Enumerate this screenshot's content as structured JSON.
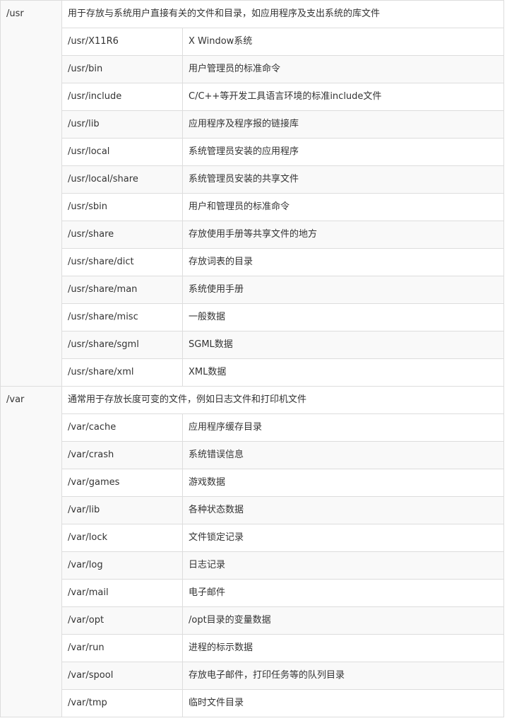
{
  "groups": [
    {
      "dir": "/usr",
      "description": "用于存放与系统用户直接有关的文件和目录，如应用程序及支出系统的库文件",
      "children": [
        {
          "path": "/usr/X11R6",
          "desc": "X Window系统"
        },
        {
          "path": "/usr/bin",
          "desc": "用户管理员的标准命令"
        },
        {
          "path": "/usr/include",
          "desc": "C/C++等开发工具语言环境的标准include文件"
        },
        {
          "path": "/usr/lib",
          "desc": "应用程序及程序报的链接库"
        },
        {
          "path": "/usr/local",
          "desc": "系统管理员安装的应用程序"
        },
        {
          "path": "/usr/local/share",
          "desc": "系统管理员安装的共享文件"
        },
        {
          "path": "/usr/sbin",
          "desc": "用户和管理员的标准命令"
        },
        {
          "path": "/usr/share",
          "desc": "存放使用手册等共享文件的地方"
        },
        {
          "path": "/usr/share/dict",
          "desc": "存放词表的目录"
        },
        {
          "path": "/usr/share/man",
          "desc": "系统使用手册"
        },
        {
          "path": "/usr/share/misc",
          "desc": "一般数据"
        },
        {
          "path": "/usr/share/sgml",
          "desc": "SGML数据"
        },
        {
          "path": "/usr/share/xml",
          "desc": "XML数据"
        }
      ]
    },
    {
      "dir": "/var",
      "description": "通常用于存放长度可变的文件，例如日志文件和打印机文件",
      "children": [
        {
          "path": "/var/cache",
          "desc": "应用程序缓存目录"
        },
        {
          "path": "/var/crash",
          "desc": "系统错误信息"
        },
        {
          "path": "/var/games",
          "desc": "游戏数据"
        },
        {
          "path": "/var/lib",
          "desc": "各种状态数据"
        },
        {
          "path": "/var/lock",
          "desc": "文件锁定记录"
        },
        {
          "path": "/var/log",
          "desc": "日志记录"
        },
        {
          "path": "/var/mail",
          "desc": "电子邮件"
        },
        {
          "path": "/var/opt",
          "desc": "/opt目录的变量数据"
        },
        {
          "path": "/var/run",
          "desc": "进程的标示数据"
        },
        {
          "path": "/var/spool",
          "desc": "存放电子邮件，打印任务等的队列目录"
        },
        {
          "path": "/var/tmp",
          "desc": "临时文件目录"
        }
      ]
    }
  ]
}
